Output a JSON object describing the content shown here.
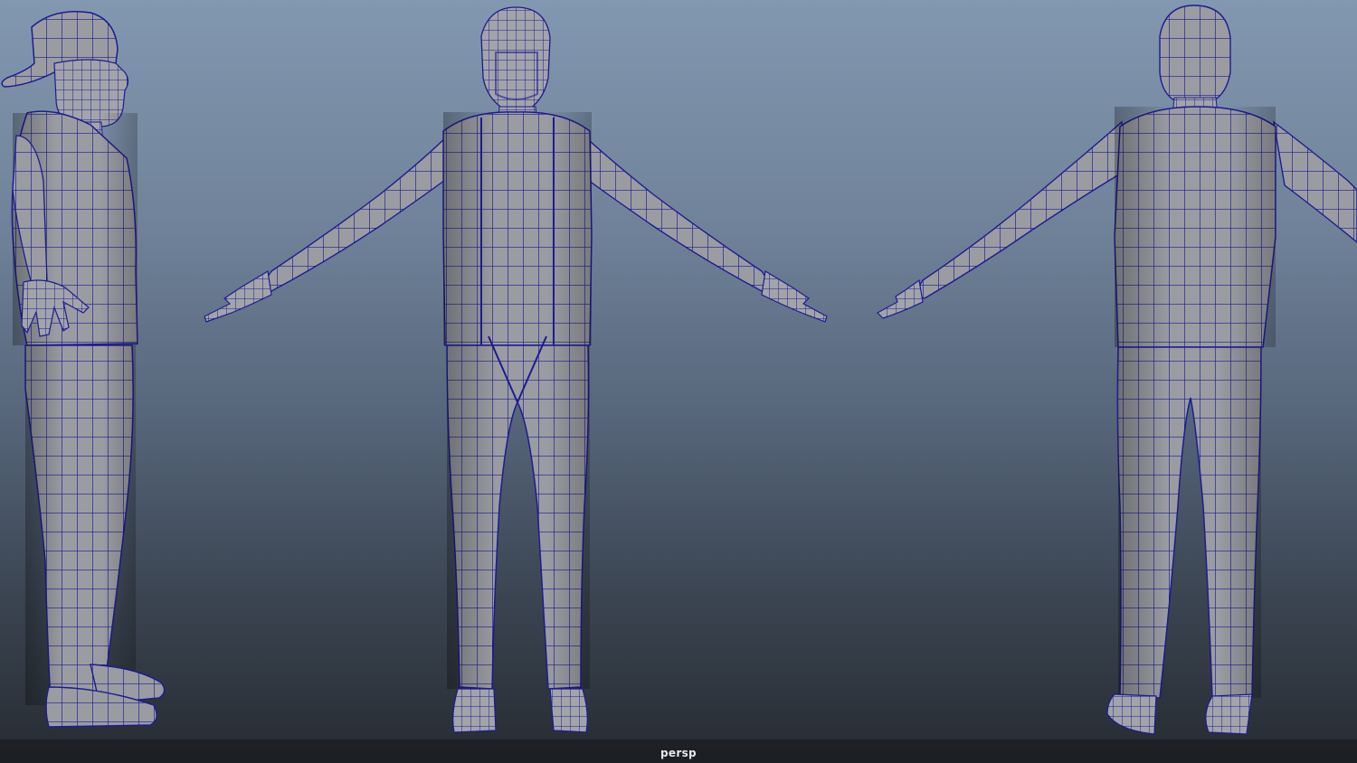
{
  "viewport": {
    "camera_label": "persp",
    "background_top_color": "#8298b0",
    "background_bottom_color": "#262b31",
    "mesh_fill_color": "#9a9ca2",
    "wire_color": "#1a1a8c"
  },
  "models": [
    {
      "view": "side",
      "icon": "character-mesh-side"
    },
    {
      "view": "front",
      "icon": "character-mesh-front"
    },
    {
      "view": "back",
      "icon": "character-mesh-back"
    }
  ]
}
